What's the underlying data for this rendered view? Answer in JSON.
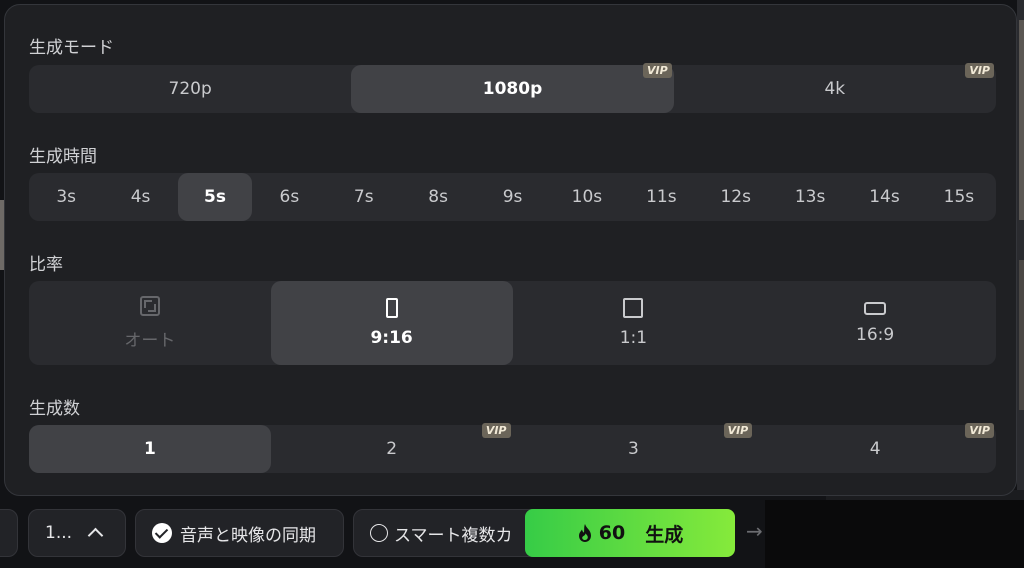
{
  "mode": {
    "label": "生成モード",
    "options": [
      {
        "label": "720p",
        "vip": ""
      },
      {
        "label": "1080p",
        "vip": "VIP"
      },
      {
        "label": "4k",
        "vip": "VIP"
      }
    ],
    "selected": "1080p"
  },
  "duration": {
    "label": "生成時間",
    "options": [
      "3s",
      "4s",
      "5s",
      "6s",
      "7s",
      "8s",
      "9s",
      "10s",
      "11s",
      "12s",
      "13s",
      "14s",
      "15s"
    ],
    "selected": "5s"
  },
  "ratio": {
    "label": "比率",
    "options": [
      {
        "label": "オート",
        "icon": "auto-ratio-icon",
        "disabled": true
      },
      {
        "label": "9:16",
        "icon": "portrait-ratio-icon"
      },
      {
        "label": "1:1",
        "icon": "square-ratio-icon"
      },
      {
        "label": "16:9",
        "icon": "landscape-ratio-icon"
      }
    ],
    "selected": "9:16"
  },
  "count": {
    "label": "生成数",
    "options": [
      {
        "label": "1",
        "vip": ""
      },
      {
        "label": "2",
        "vip": "VIP"
      },
      {
        "label": "3",
        "vip": "VIP"
      },
      {
        "label": "4",
        "vip": "VIP"
      }
    ],
    "selected": "1"
  },
  "toolbar": {
    "count_button": "1...",
    "sync_label": "音声と映像の同期",
    "smart_label": "スマート複数カ",
    "generate": {
      "credits": "60",
      "label": "生成"
    },
    "arrow": "→"
  },
  "colors": {
    "accent_gradient_start": "#36cc47",
    "accent_gradient_end": "#86ea3b",
    "vip_badge": "#6b6559",
    "active_segment": "#414246"
  }
}
